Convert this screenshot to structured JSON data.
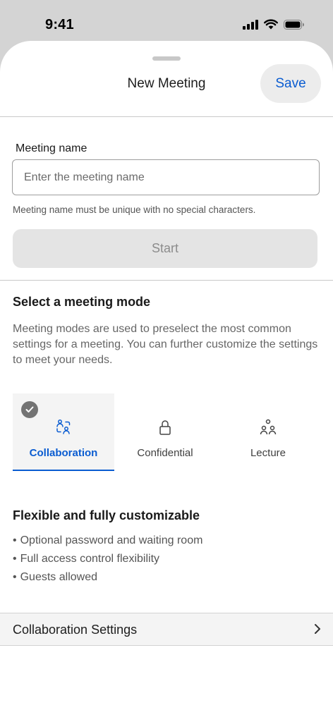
{
  "status_bar": {
    "time": "9:41"
  },
  "sheet": {
    "title": "New Meeting",
    "save_label": "Save"
  },
  "meeting_name": {
    "label": "Meeting name",
    "placeholder": "Enter the meeting name",
    "value": "",
    "helper": "Meeting name must be unique with no special characters."
  },
  "start_label": "Start",
  "mode_section": {
    "title": "Select a meeting mode",
    "description": "Meeting modes are used to preselect the most common settings for a meeting. You can further customize the settings to meet your needs.",
    "modes": [
      {
        "label": "Collaboration",
        "icon": "people-icon",
        "selected": true
      },
      {
        "label": "Confidential",
        "icon": "lock-icon",
        "selected": false
      },
      {
        "label": "Lecture",
        "icon": "audience-icon",
        "selected": false
      }
    ]
  },
  "mode_details": {
    "title": "Flexible and fully customizable",
    "features": [
      "Optional password and waiting room",
      "Full access control flexibility",
      "Guests allowed"
    ]
  },
  "settings_row": {
    "label": "Collaboration Settings"
  },
  "colors": {
    "accent": "#0a5cd1",
    "selected_tab_bg": "#f4f4f4",
    "disabled_button_bg": "#e4e4e4",
    "check_badge": "#737373"
  }
}
